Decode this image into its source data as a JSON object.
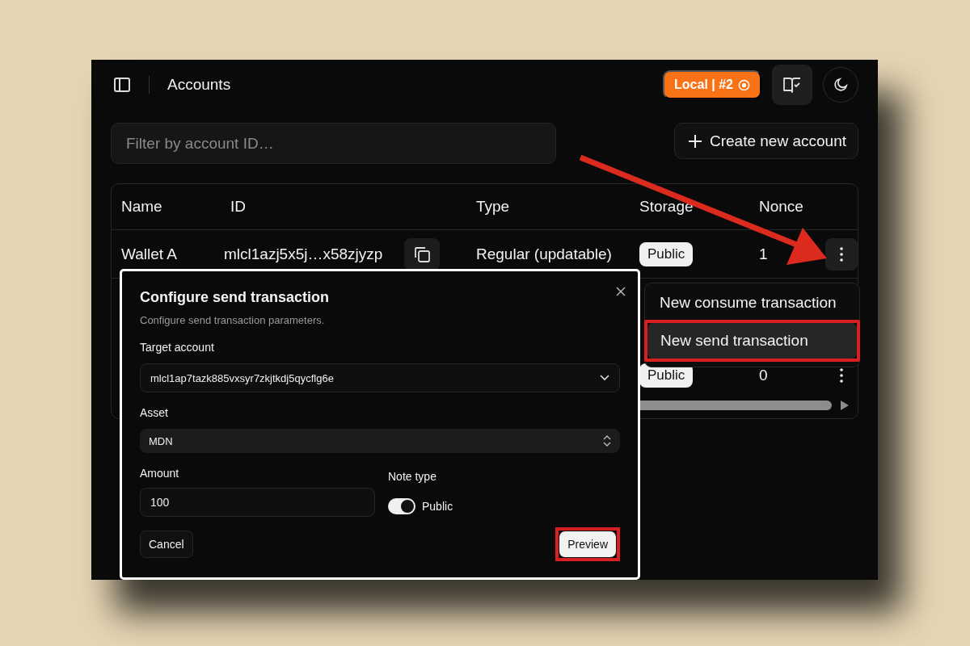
{
  "header": {
    "title": "Accounts",
    "network_badge": "Local | #2"
  },
  "filter": {
    "placeholder": "Filter by account ID…"
  },
  "create_button": "Create new account",
  "table": {
    "columns": [
      "Name",
      "ID",
      "Type",
      "Storage",
      "Nonce"
    ],
    "rows": [
      {
        "name": "Wallet A",
        "id": "mlcl1azj5x5j…x58zjyzp",
        "type": "Regular (updatable)",
        "storage_mode": "Public",
        "nonce": "1"
      },
      {
        "storage_mode": "Public",
        "nonce": "0"
      }
    ]
  },
  "row_menu": {
    "items": [
      {
        "label": "New consume transaction",
        "selected": false,
        "highlighted": false
      },
      {
        "label": "New send transaction",
        "selected": true,
        "highlighted": true
      }
    ]
  },
  "dialog": {
    "title": "Configure send transaction",
    "description": "Configure send transaction parameters.",
    "target_account": {
      "label": "Target account",
      "value": "mlcl1ap7tazk885vxsyr7zkjtkdj5qycflg6e"
    },
    "asset": {
      "label": "Asset",
      "value": "MDN"
    },
    "amount": {
      "label": "Amount",
      "value": "100"
    },
    "note_type": {
      "label": "Note type",
      "on": true,
      "text": "Public"
    },
    "cancel": {
      "label": "Cancel",
      "highlighted": false
    },
    "preview": {
      "label": "Preview",
      "highlighted": true
    }
  }
}
